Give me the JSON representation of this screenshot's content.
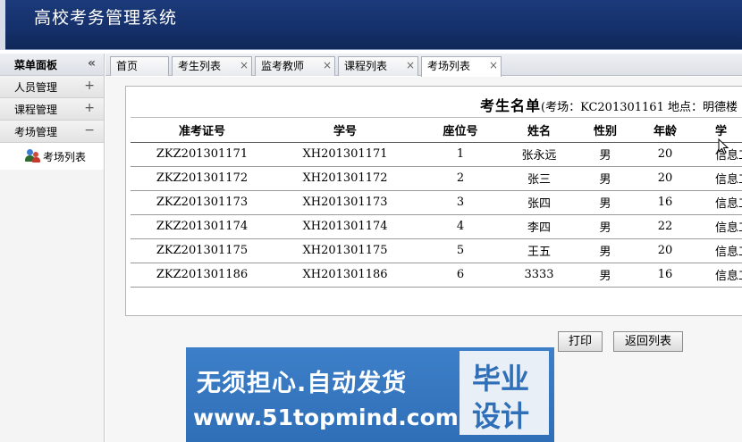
{
  "header": {
    "title": "高校考务管理系统"
  },
  "sidebar": {
    "head": "菜单面板",
    "collapse_glyph": "«",
    "items": [
      {
        "label": "人员管理",
        "symbol": "+"
      },
      {
        "label": "课程管理",
        "symbol": "+"
      },
      {
        "label": "考场管理",
        "symbol": "−"
      }
    ],
    "sub_items": [
      {
        "label": "考场列表"
      }
    ]
  },
  "tabs": [
    {
      "label": "首页",
      "closable": false
    },
    {
      "label": "考生列表",
      "closable": true
    },
    {
      "label": "监考教师",
      "closable": true
    },
    {
      "label": "课程列表",
      "closable": true
    },
    {
      "label": "考场列表",
      "closable": true,
      "active": true
    }
  ],
  "tab_close_glyph": "×",
  "roster": {
    "title": "考生名单",
    "info": "(考场：KC201301161 地点：明德楼",
    "columns": [
      "准考证号",
      "学号",
      "座位号",
      "姓名",
      "性别",
      "年龄",
      "学"
    ],
    "rows": [
      [
        "ZKZ201301171",
        "XH201301171",
        "1",
        "张永远",
        "男",
        "20",
        "信息工"
      ],
      [
        "ZKZ201301172",
        "XH201301172",
        "2",
        "张三",
        "男",
        "20",
        "信息工"
      ],
      [
        "ZKZ201301173",
        "XH201301173",
        "3",
        "张四",
        "男",
        "16",
        "信息工"
      ],
      [
        "ZKZ201301174",
        "XH201301174",
        "4",
        "李四",
        "男",
        "22",
        "信息工"
      ],
      [
        "ZKZ201301175",
        "XH201301175",
        "5",
        "王五",
        "男",
        "20",
        "信息工"
      ],
      [
        "ZKZ201301186",
        "XH201301186",
        "6",
        "3333",
        "男",
        "16",
        "信息工"
      ]
    ]
  },
  "buttons": {
    "print": "打印",
    "back": "返回列表"
  },
  "watermark": {
    "line1": "无须担心.自动发货",
    "line2": "www.51topmind.com",
    "box1": "毕业",
    "box2": "设计"
  }
}
